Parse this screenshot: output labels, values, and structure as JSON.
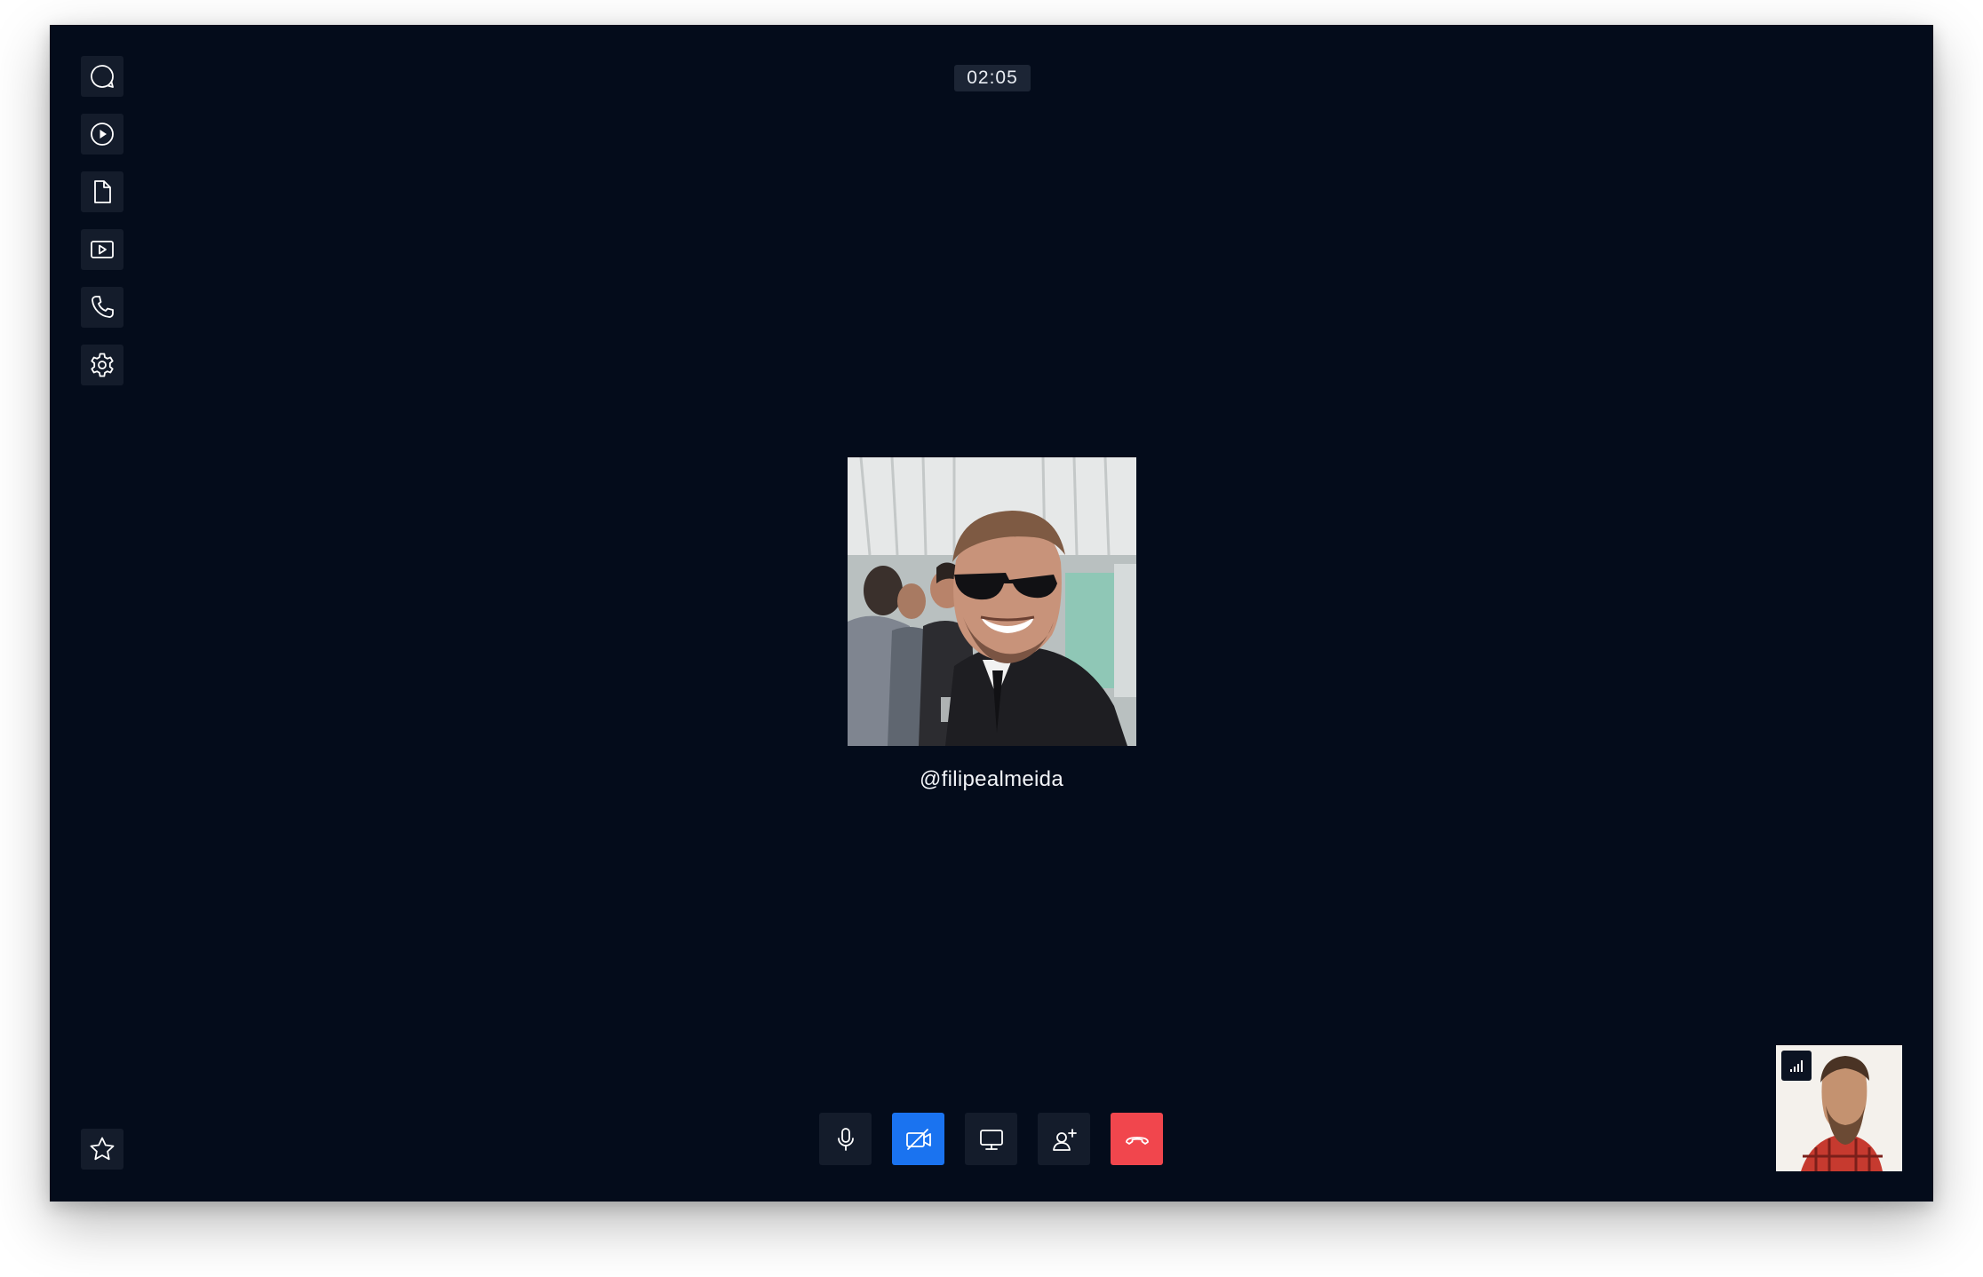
{
  "call": {
    "timer": "02:05",
    "caller_handle": "@filipealmeida",
    "caller_photo_alt": "filipealmeida"
  },
  "sidebar": {
    "items": [
      {
        "icon": "chat-bubble-icon"
      },
      {
        "icon": "play-circle-icon"
      },
      {
        "icon": "document-icon"
      },
      {
        "icon": "video-player-icon"
      },
      {
        "icon": "phone-icon"
      },
      {
        "icon": "gear-icon"
      }
    ],
    "bottom_item": {
      "icon": "star-icon"
    }
  },
  "controls": [
    {
      "icon": "microphone-icon",
      "state": "default"
    },
    {
      "icon": "camera-off-icon",
      "state": "active"
    },
    {
      "icon": "screen-share-icon",
      "state": "default"
    },
    {
      "icon": "add-person-icon",
      "state": "default"
    },
    {
      "icon": "hang-up-icon",
      "state": "danger"
    }
  ],
  "self_view": {
    "signal_icon": "signal-strength-icon"
  },
  "colors": {
    "background": "#040c1b",
    "button": "#141c2b",
    "accent": "#1a73f0",
    "danger": "#f1464d",
    "text": "#f2f4f8"
  }
}
